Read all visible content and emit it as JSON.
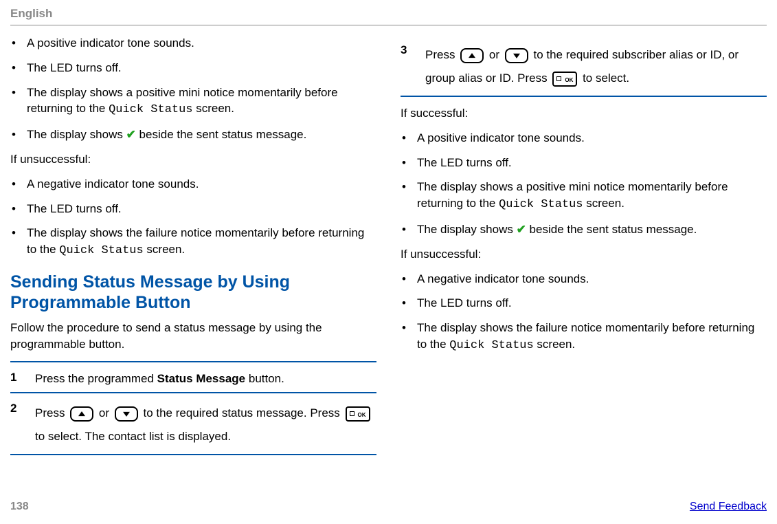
{
  "header": {
    "lang": "English"
  },
  "left": {
    "bullets1": [
      {
        "t": "A positive indicator tone sounds."
      },
      {
        "t": "The LED turns off."
      },
      {
        "pre": "The display shows a positive mini notice momentarily before returning to the ",
        "mono": "Quick Status",
        "post": " screen."
      },
      {
        "pre": "The display shows ",
        "check": true,
        "post": " beside the sent status message."
      }
    ],
    "unsucc_label": "If unsuccessful:",
    "bullets2": [
      {
        "t": "A negative indicator tone sounds."
      },
      {
        "t": "The LED turns off."
      },
      {
        "pre": "The display shows the failure notice momentarily before returning to the ",
        "mono": "Quick Status",
        "post": " screen."
      }
    ],
    "h2_line1": "Sending Status Message by Using",
    "h2_line2": "Programmable Button",
    "h2_desc": "Follow the procedure to send a status message by using the programmable button.",
    "step1_pre": "Press the programmed ",
    "step1_bold": "Status Message",
    "step1_post": " button.",
    "step2_a": "Press ",
    "step2_mid": " or ",
    "step2_b": " to the required status message. Press ",
    "step2_end": " to select. The contact list is displayed.",
    "nums": {
      "one": "1",
      "two": "2"
    }
  },
  "right": {
    "num3": "3",
    "step3_a": "Press ",
    "step3_mid": " or ",
    "step3_b": " to the required subscriber alias or ID, or group alias or ID. Press ",
    "step3_end": " to select.",
    "succ_label": "If successful:",
    "bullets_s": [
      {
        "t": "A positive indicator tone sounds."
      },
      {
        "t": "The LED turns off."
      },
      {
        "pre": "The display shows a positive mini notice momentarily before returning to the ",
        "mono": "Quick Status",
        "post": " screen."
      },
      {
        "pre": "The display shows ",
        "check": true,
        "post": " beside the sent status message."
      }
    ],
    "unsucc_label": "If unsuccessful:",
    "bullets_u": [
      {
        "t": "A negative indicator tone sounds."
      },
      {
        "t": "The LED turns off."
      },
      {
        "pre": "The display shows the failure notice momentarily before returning to the ",
        "mono": "Quick Status",
        "post": " screen."
      }
    ]
  },
  "footer": {
    "page": "138",
    "feedback": "Send Feedback"
  }
}
